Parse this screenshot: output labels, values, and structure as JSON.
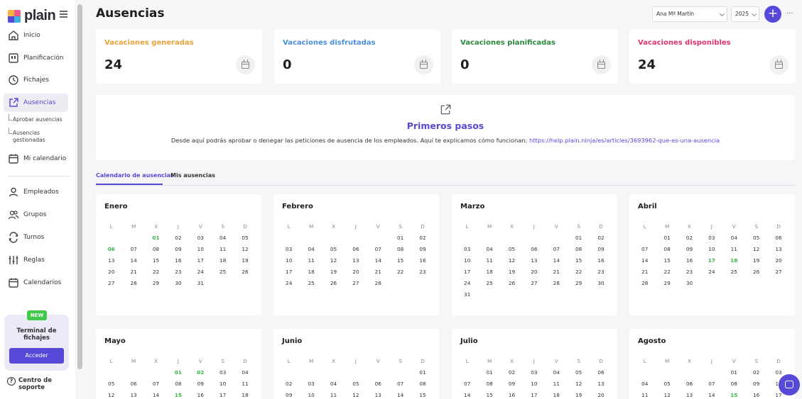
{
  "app": {
    "logo_text": "plain"
  },
  "sidebar": {
    "items": [
      {
        "label": "Inicio",
        "icon": "home-icon"
      },
      {
        "label": "Planificación",
        "icon": "planning-icon"
      },
      {
        "label": "Fichajes",
        "icon": "clock-icon"
      },
      {
        "label": "Ausencias",
        "icon": "external-link-icon",
        "active": true
      },
      {
        "label": "Mi calendario",
        "icon": "calendar-icon"
      },
      {
        "label": "Empleados",
        "icon": "user-icon"
      },
      {
        "label": "Grupos",
        "icon": "users-icon"
      },
      {
        "label": "Turnos",
        "icon": "shift-icon"
      },
      {
        "label": "Reglas",
        "icon": "sliders-icon"
      },
      {
        "label": "Calendarios",
        "icon": "calendar-icon"
      }
    ],
    "subitems": [
      "Aprobar ausencias",
      "Ausencias gestionadas"
    ],
    "promo": {
      "badge": "NEW",
      "title": "Terminal de fichajes",
      "button": "Acceder"
    },
    "help": "Centro de soporte"
  },
  "header": {
    "title": "Ausencias",
    "employee_select": "Ana Mª Martín",
    "year_select": "2025",
    "add_label": "+",
    "more_label": "···"
  },
  "stats": [
    {
      "label": "Vacaciones generadas",
      "value": "24",
      "color": "#e7a23b"
    },
    {
      "label": "Vacaciones disfrutadas",
      "value": "0",
      "color": "#4a8fdb"
    },
    {
      "label": "Vacaciones planificadas",
      "value": "0",
      "color": "#2a8a3e"
    },
    {
      "label": "Vacaciones disponibles",
      "value": "24",
      "color": "#e0336b"
    }
  ],
  "banner": {
    "title": "Primeros pasos",
    "text": "Desde aquí podrás aprobar o denegar las peticiones de ausencia de los empleados. Aquí te explicamos cómo funcionan:",
    "link": "https://help.plain.ninja/es/articles/3693962-que-es-una-ausencia"
  },
  "tabs": [
    {
      "label": "Calendario de ausencias",
      "active": true
    },
    {
      "label": "Mis ausencias",
      "active": false
    }
  ],
  "weekdays": [
    "L",
    "M",
    "X",
    "J",
    "V",
    "S",
    "D"
  ],
  "months": [
    {
      "name": "Enero",
      "rows": [
        [
          "",
          "",
          "01",
          "02",
          "03",
          "04",
          "05"
        ],
        [
          "06",
          "07",
          "08",
          "09",
          "10",
          "11",
          "12"
        ],
        [
          "13",
          "14",
          "15",
          "16",
          "17",
          "18",
          "19"
        ],
        [
          "20",
          "21",
          "22",
          "23",
          "24",
          "25",
          "26"
        ],
        [
          "27",
          "28",
          "29",
          "30",
          "31",
          "",
          ""
        ]
      ],
      "highlight": [
        "01",
        "06"
      ]
    },
    {
      "name": "Febrero",
      "rows": [
        [
          "",
          "",
          "",
          "",
          "",
          "01",
          "02"
        ],
        [
          "03",
          "04",
          "05",
          "06",
          "07",
          "08",
          "09"
        ],
        [
          "10",
          "11",
          "12",
          "13",
          "14",
          "15",
          "16"
        ],
        [
          "17",
          "18",
          "19",
          "20",
          "21",
          "22",
          "23"
        ],
        [
          "24",
          "25",
          "26",
          "27",
          "28",
          "",
          ""
        ]
      ],
      "highlight": []
    },
    {
      "name": "Marzo",
      "rows": [
        [
          "",
          "",
          "",
          "",
          "",
          "01",
          "02"
        ],
        [
          "03",
          "04",
          "05",
          "06",
          "07",
          "08",
          "09"
        ],
        [
          "10",
          "11",
          "12",
          "13",
          "14",
          "15",
          "16"
        ],
        [
          "17",
          "18",
          "19",
          "20",
          "21",
          "22",
          "23"
        ],
        [
          "24",
          "25",
          "26",
          "27",
          "28",
          "29",
          "30"
        ],
        [
          "31",
          "",
          "",
          "",
          "",
          "",
          ""
        ]
      ],
      "highlight": []
    },
    {
      "name": "Abril",
      "rows": [
        [
          "",
          "01",
          "02",
          "03",
          "04",
          "05",
          "06"
        ],
        [
          "07",
          "08",
          "09",
          "10",
          "11",
          "12",
          "13"
        ],
        [
          "14",
          "15",
          "16",
          "17",
          "18",
          "19",
          "20"
        ],
        [
          "21",
          "22",
          "23",
          "24",
          "25",
          "26",
          "27"
        ],
        [
          "28",
          "29",
          "30",
          "",
          "",
          "",
          ""
        ]
      ],
      "highlight": [
        "17",
        "18"
      ]
    },
    {
      "name": "Mayo",
      "rows": [
        [
          "",
          "",
          "",
          "01",
          "02",
          "03",
          "04"
        ],
        [
          "05",
          "06",
          "07",
          "08",
          "09",
          "10",
          "11"
        ],
        [
          "12",
          "13",
          "14",
          "15",
          "16",
          "17",
          "18"
        ]
      ],
      "highlight": [
        "01",
        "02",
        "15"
      ]
    },
    {
      "name": "Junio",
      "rows": [
        [
          "",
          "",
          "",
          "",
          "",
          "",
          "01"
        ],
        [
          "02",
          "03",
          "04",
          "05",
          "06",
          "07",
          "08"
        ],
        [
          "09",
          "10",
          "11",
          "12",
          "13",
          "14",
          "15"
        ]
      ],
      "highlight": []
    },
    {
      "name": "Julio",
      "rows": [
        [
          "",
          "01",
          "02",
          "03",
          "04",
          "05",
          "06"
        ],
        [
          "07",
          "08",
          "09",
          "10",
          "11",
          "12",
          "13"
        ],
        [
          "14",
          "15",
          "16",
          "17",
          "18",
          "19",
          "20"
        ]
      ],
      "highlight": []
    },
    {
      "name": "Agosto",
      "rows": [
        [
          "",
          "",
          "",
          "",
          "01",
          "02",
          "03"
        ],
        [
          "04",
          "05",
          "06",
          "07",
          "08",
          "09",
          "10"
        ],
        [
          "11",
          "12",
          "13",
          "14",
          "15",
          "16",
          "17"
        ]
      ],
      "highlight": [
        "15"
      ]
    }
  ]
}
